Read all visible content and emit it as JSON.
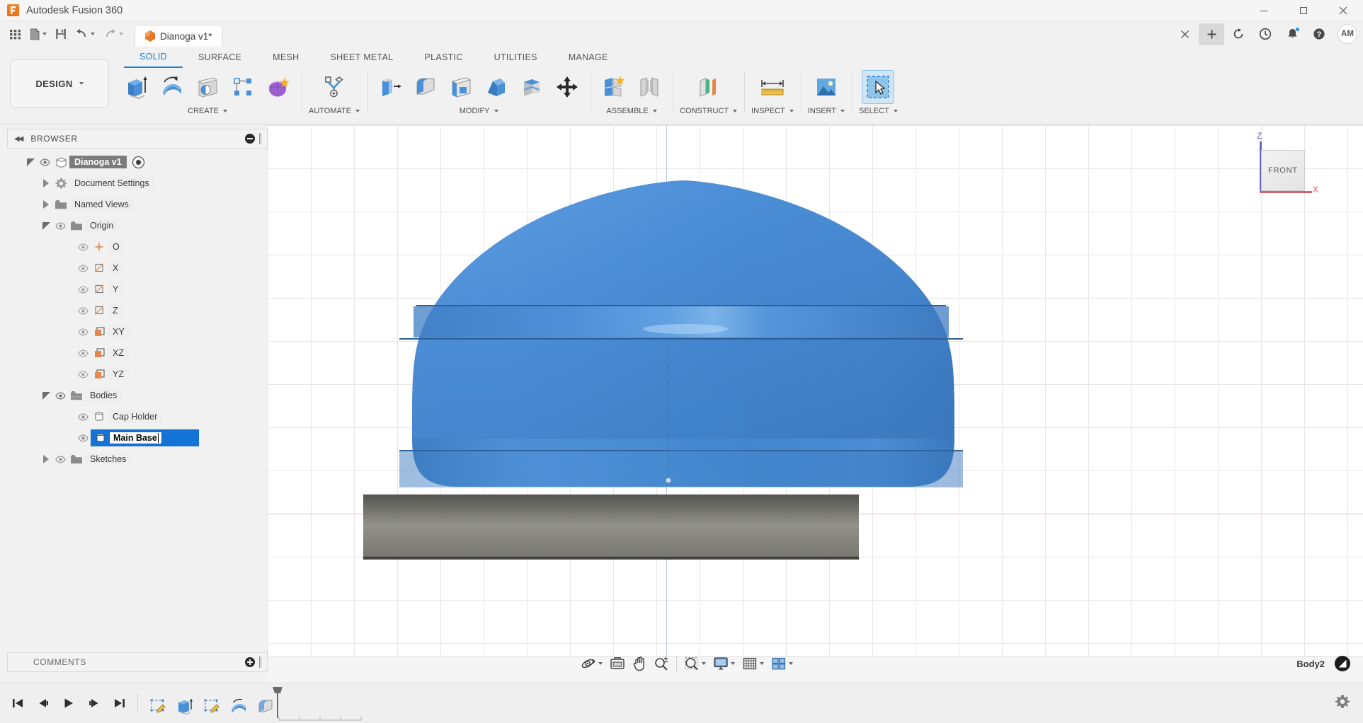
{
  "window": {
    "app_title": "Autodesk Fusion 360",
    "logo_icon": "fusion-logo-icon",
    "controls": [
      {
        "name": "minimize",
        "glyph": "—"
      },
      {
        "name": "maximize",
        "glyph": "❐"
      },
      {
        "name": "close",
        "glyph": "✕"
      }
    ]
  },
  "quick_access": {
    "items": [
      {
        "name": "show-data-panel",
        "icon": "grid-icon",
        "has_caret": false
      },
      {
        "name": "new-document",
        "icon": "file-icon",
        "has_caret": true
      },
      {
        "name": "save",
        "icon": "save-icon",
        "has_caret": false
      },
      {
        "name": "undo",
        "icon": "undo-arrow-icon",
        "has_caret": true
      },
      {
        "name": "redo",
        "icon": "redo-arrow-icon",
        "has_caret": true
      }
    ]
  },
  "document_tab": {
    "label": "Dianoga v1*",
    "icon": "orange-cube-icon",
    "close_glyph": "✕"
  },
  "tab_actions": [
    {
      "name": "close-tab",
      "icon": "close-icon",
      "glyph": "✕"
    },
    {
      "name": "new-tab",
      "icon": "plus-icon",
      "glyph": "＋"
    },
    {
      "name": "extensions",
      "icon": "refresh-circle-icon",
      "glyph": "⟳"
    },
    {
      "name": "recent-activity",
      "icon": "clock-icon",
      "glyph": "◴"
    },
    {
      "name": "notifications",
      "icon": "bell-icon",
      "glyph": "🔔",
      "badge": true
    },
    {
      "name": "help",
      "icon": "question-circle-icon",
      "glyph": "?"
    }
  ],
  "account": {
    "initials": "AM"
  },
  "ribbon": {
    "workspace_label": "DESIGN",
    "tabs": [
      {
        "label": "SOLID",
        "active": true
      },
      {
        "label": "SURFACE",
        "active": false
      },
      {
        "label": "MESH",
        "active": false
      },
      {
        "label": "SHEET METAL",
        "active": false
      },
      {
        "label": "PLASTIC",
        "active": false
      },
      {
        "label": "UTILITIES",
        "active": false
      },
      {
        "label": "MANAGE",
        "active": false
      }
    ],
    "panels": [
      {
        "label": "CREATE",
        "has_caret": true,
        "tools": [
          {
            "name": "extrude-tool",
            "icon": "extrude-icon"
          },
          {
            "name": "revolve-tool",
            "icon": "revolve-icon"
          },
          {
            "name": "hole-tool",
            "icon": "hole-icon"
          },
          {
            "name": "pattern-tool",
            "icon": "rectangular-pattern-icon"
          },
          {
            "name": "create-form-tool",
            "icon": "form-sculpt-icon"
          }
        ]
      },
      {
        "label": "AUTOMATE",
        "has_caret": true,
        "tools": [
          {
            "name": "automated-modeling-tool",
            "icon": "automate-icon"
          }
        ]
      },
      {
        "label": "MODIFY",
        "has_caret": true,
        "tools": [
          {
            "name": "press-pull-tool",
            "icon": "press-pull-icon"
          },
          {
            "name": "fillet-tool",
            "icon": "fillet-icon"
          },
          {
            "name": "shell-tool",
            "icon": "shell-icon"
          },
          {
            "name": "draft-tool",
            "icon": "draft-icon"
          },
          {
            "name": "split-face-tool",
            "icon": "split-face-icon"
          },
          {
            "name": "move-copy-tool",
            "icon": "move-arrows-icon"
          }
        ]
      },
      {
        "label": "ASSEMBLE",
        "has_caret": true,
        "tools": [
          {
            "name": "new-component-tool",
            "icon": "new-component-icon"
          },
          {
            "name": "joint-tool",
            "icon": "joint-icon"
          }
        ]
      },
      {
        "label": "CONSTRUCT",
        "has_caret": true,
        "tools": [
          {
            "name": "offset-plane-tool",
            "icon": "offset-plane-icon"
          }
        ]
      },
      {
        "label": "INSPECT",
        "has_caret": true,
        "tools": [
          {
            "name": "measure-tool",
            "icon": "measure-ruler-icon"
          }
        ]
      },
      {
        "label": "INSERT",
        "has_caret": true,
        "tools": [
          {
            "name": "insert-canvas-tool",
            "icon": "image-icon"
          }
        ]
      },
      {
        "label": "SELECT",
        "has_caret": true,
        "tools": [
          {
            "name": "select-tool",
            "icon": "cursor-select-icon"
          }
        ]
      }
    ]
  },
  "browser": {
    "title": "BROWSER",
    "collapse_icon": "double-left-arrow-icon",
    "minimize_icon": "minus-circle-icon",
    "nodes": [
      {
        "label": "Dianoga v1",
        "indent": 0,
        "twist": "down",
        "eye": true,
        "icon": "component-cube-icon",
        "selected": true,
        "activate_dot": true
      },
      {
        "label": "Document Settings",
        "indent": 1,
        "twist": "right",
        "eye": false,
        "icon": "gear-icon"
      },
      {
        "label": "Named Views",
        "indent": 1,
        "twist": "right",
        "eye": false,
        "icon": "folder-icon"
      },
      {
        "label": "Origin",
        "indent": 1,
        "twist": "down",
        "eye": true,
        "icon": "folder-icon"
      },
      {
        "label": "O",
        "indent": 2,
        "twist": "none",
        "eye": true,
        "icon": "origin-point-icon"
      },
      {
        "label": "X",
        "indent": 2,
        "twist": "none",
        "eye": true,
        "icon": "axis-icon"
      },
      {
        "label": "Y",
        "indent": 2,
        "twist": "none",
        "eye": true,
        "icon": "axis-icon"
      },
      {
        "label": "Z",
        "indent": 2,
        "twist": "none",
        "eye": true,
        "icon": "axis-icon"
      },
      {
        "label": "XY",
        "indent": 2,
        "twist": "none",
        "eye": true,
        "icon": "plane-icon"
      },
      {
        "label": "XZ",
        "indent": 2,
        "twist": "none",
        "eye": true,
        "icon": "plane-icon"
      },
      {
        "label": "YZ",
        "indent": 2,
        "twist": "none",
        "eye": true,
        "icon": "plane-icon"
      },
      {
        "label": "Bodies",
        "indent": 1,
        "twist": "down",
        "eye": true,
        "icon": "bodies-folder-icon"
      },
      {
        "label": "Cap Holder",
        "indent": 2,
        "twist": "none",
        "eye": true,
        "icon": "body-icon"
      },
      {
        "label": "Main Base",
        "indent": 2,
        "twist": "none",
        "eye": true,
        "icon": "body-icon",
        "editing": true
      },
      {
        "label": "Sketches",
        "indent": 1,
        "twist": "right",
        "eye": true,
        "icon": "folder-icon"
      }
    ]
  },
  "comments": {
    "title": "COMMENTS",
    "add_icon": "plus-circle-icon"
  },
  "viewcube": {
    "face_label": "FRONT",
    "z_label": "Z",
    "x_label": "X"
  },
  "navbar": {
    "items": [
      {
        "name": "orbit-button",
        "icon": "orbit-icon",
        "has_caret": true
      },
      {
        "name": "look-at-button",
        "icon": "look-at-icon",
        "has_caret": false
      },
      {
        "name": "pan-button",
        "icon": "pan-hand-icon",
        "has_caret": false
      },
      {
        "name": "zoom-button",
        "icon": "zoom-magnifier-icon",
        "has_caret": false
      },
      {
        "name": "zoom-window-button",
        "icon": "zoom-window-icon",
        "has_caret": true
      },
      {
        "name": "display-settings-button",
        "icon": "monitor-icon",
        "has_caret": true
      },
      {
        "name": "grid-snaps-button",
        "icon": "grid-icon",
        "has_caret": true
      },
      {
        "name": "viewports-button",
        "icon": "viewport-layout-icon",
        "has_caret": true
      }
    ]
  },
  "status": {
    "body_label": "Body2",
    "hub_icon": "fusion-hub-icon"
  },
  "timeline": {
    "playback": [
      {
        "name": "go-to-beginning",
        "icon": "skip-start-icon"
      },
      {
        "name": "step-back",
        "icon": "step-back-icon"
      },
      {
        "name": "play",
        "icon": "play-icon"
      },
      {
        "name": "step-forward",
        "icon": "step-forward-icon"
      },
      {
        "name": "go-to-end",
        "icon": "skip-end-icon"
      }
    ],
    "features": [
      {
        "name": "timeline-feature-sketch-1",
        "icon": "sketch-icon"
      },
      {
        "name": "timeline-feature-extrude-1",
        "icon": "extrude-icon"
      },
      {
        "name": "timeline-feature-sketch-2",
        "icon": "sketch-icon"
      },
      {
        "name": "timeline-feature-revolve-1",
        "icon": "revolve-icon"
      },
      {
        "name": "timeline-feature-fillet-1",
        "icon": "fillet-icon"
      }
    ],
    "settings_icon": "gear-icon"
  }
}
